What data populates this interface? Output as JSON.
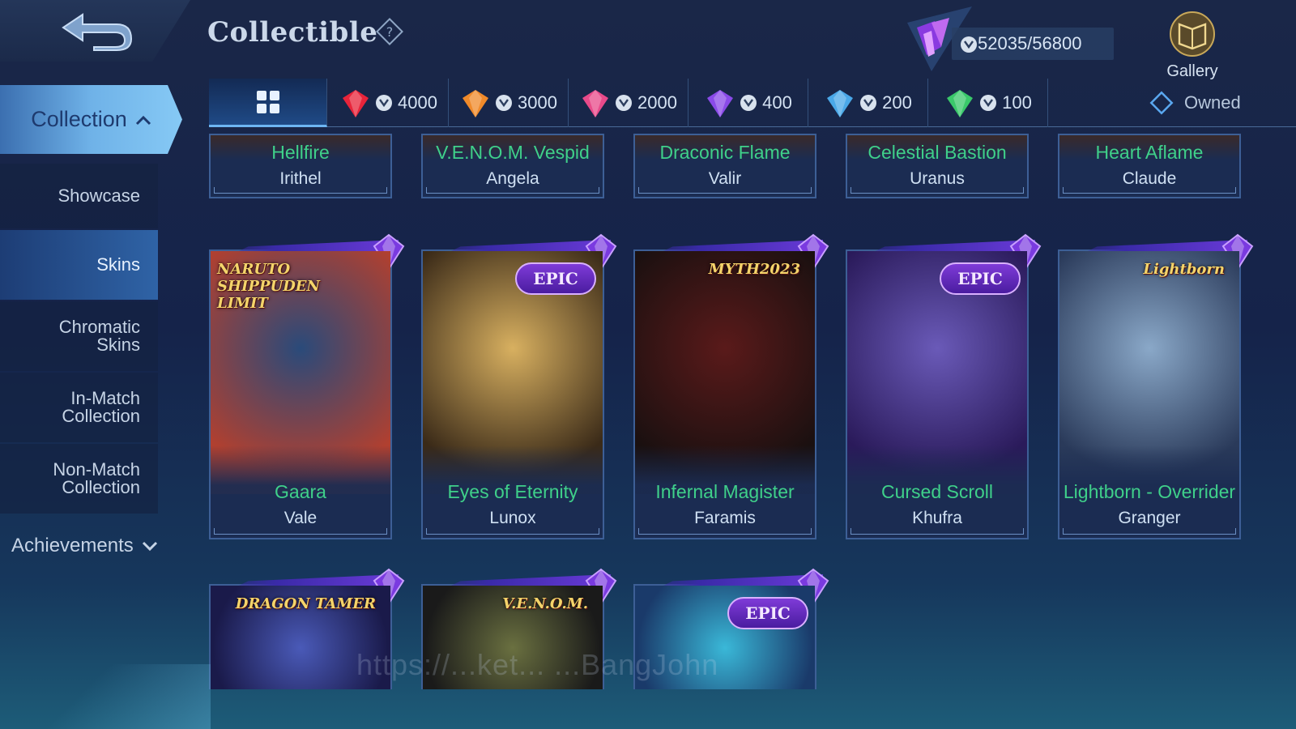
{
  "header": {
    "title": "Collectible",
    "points": "52035/56800",
    "gallery_label": "Gallery"
  },
  "sidebar": {
    "collection_label": "Collection",
    "items": [
      {
        "label": "Showcase"
      },
      {
        "label": "Skins"
      },
      {
        "label": "Chromatic\nSkins"
      },
      {
        "label": "In-Match\nCollection"
      },
      {
        "label": "Non-Match\nCollection"
      }
    ],
    "achievements_label": "Achievements"
  },
  "filters": {
    "tabs": [
      {
        "value": "4000",
        "color": "#e8243a"
      },
      {
        "value": "3000",
        "color": "#f08a2a"
      },
      {
        "value": "2000",
        "color": "#e84a8a"
      },
      {
        "value": "400",
        "color": "#8a4ae8"
      },
      {
        "value": "200",
        "color": "#4aa8e8"
      },
      {
        "value": "100",
        "color": "#3ac86a"
      }
    ],
    "owned_label": "Owned"
  },
  "cards_row1": [
    {
      "skin": "Hellfire",
      "hero": "Irithel"
    },
    {
      "skin": "V.E.N.O.M. Vespid",
      "hero": "Angela"
    },
    {
      "skin": "Draconic Flame",
      "hero": "Valir"
    },
    {
      "skin": "Celestial Bastion",
      "hero": "Uranus"
    },
    {
      "skin": "Heart Aflame",
      "hero": "Claude"
    }
  ],
  "cards_row2": [
    {
      "skin": "Gaara",
      "hero": "Vale",
      "badge": "NARUTO SHIPPUDEN LIMIT",
      "art_colors": [
        "#2a4a7a",
        "#b04030"
      ]
    },
    {
      "skin": "Eyes of Eternity",
      "hero": "Lunox",
      "badge": "EPIC",
      "art_colors": [
        "#d8b060",
        "#3a2a18"
      ]
    },
    {
      "skin": "Infernal Magister",
      "hero": "Faramis",
      "badge": "MYTH2023",
      "art_colors": [
        "#5a1a1a",
        "#1a1010"
      ]
    },
    {
      "skin": "Cursed Scroll",
      "hero": "Khufra",
      "badge": "EPIC",
      "art_colors": [
        "#6a5ab8",
        "#2a1a5a"
      ]
    },
    {
      "skin": "Lightborn - Overrider",
      "hero": "Granger",
      "badge": "Lightborn",
      "art_colors": [
        "#8aa8c8",
        "#2a3a5a"
      ]
    }
  ],
  "cards_row3": [
    {
      "badge": "DRAGON TAMER",
      "art_colors": [
        "#4a5ab8",
        "#1a1a4a"
      ]
    },
    {
      "badge": "V.E.N.O.M.",
      "art_colors": [
        "#6a7040",
        "#1a1a1a"
      ]
    },
    {
      "badge": "EPIC",
      "art_colors": [
        "#3ab8d8",
        "#1a3a6a"
      ]
    }
  ],
  "watermark": "https://...ket... ...BangJohn"
}
